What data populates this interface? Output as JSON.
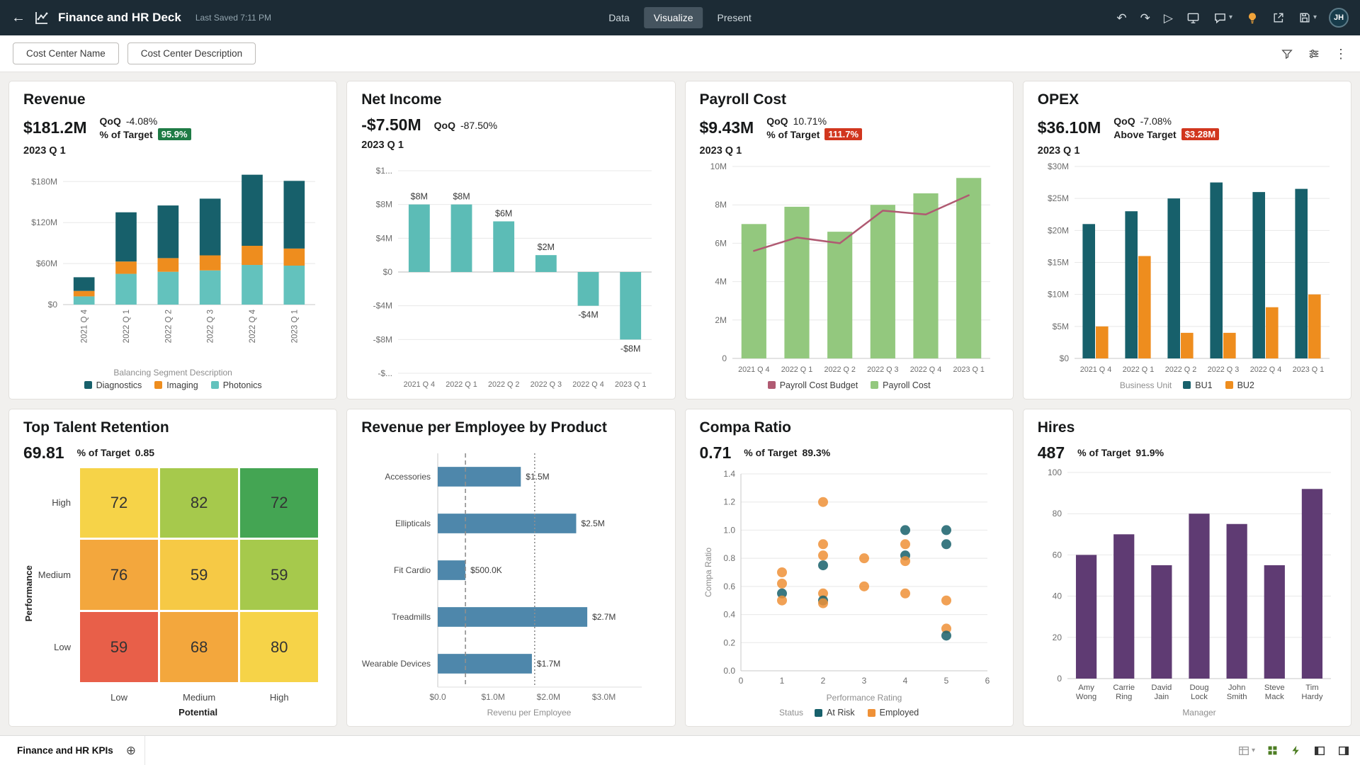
{
  "topbar": {
    "title": "Finance and HR Deck",
    "last_saved": "Last Saved 7:11 PM",
    "tabs": [
      {
        "label": "Data",
        "active": false
      },
      {
        "label": "Visualize",
        "active": true
      },
      {
        "label": "Present",
        "active": false
      }
    ],
    "avatar_initials": "JH"
  },
  "filterbar": {
    "chips": [
      {
        "label": "Cost Center Name"
      },
      {
        "label": "Cost Center Description"
      }
    ]
  },
  "bottombar": {
    "active_tab": "Finance and HR KPIs"
  },
  "tiles": [
    {
      "title": "Revenue",
      "value": "$181.2M",
      "qoq_label": "QoQ",
      "qoq_value": "-4.08%",
      "target_label": "% of Target",
      "target_value": "95.9%",
      "target_badge": "green",
      "period": "2023 Q 1",
      "legend_title": "Balancing Segment Description"
    },
    {
      "title": "Net Income",
      "value": "-$7.50M",
      "qoq_label": "QoQ",
      "qoq_value": "-87.50%",
      "period": "2023 Q 1"
    },
    {
      "title": "Payroll Cost",
      "value": "$9.43M",
      "qoq_label": "QoQ",
      "qoq_value": "10.71%",
      "target_label": "% of Target",
      "target_value": "111.7%",
      "target_badge": "red",
      "period": "2023 Q 1"
    },
    {
      "title": "OPEX",
      "value": "$36.10M",
      "qoq_label": "QoQ",
      "qoq_value": "-7.08%",
      "target_label": "Above Target",
      "target_value": "$3.28M",
      "target_badge": "red",
      "period": "2023 Q 1",
      "legend_title": "Business Unit"
    },
    {
      "title": "Top Talent Retention",
      "value": "69.81",
      "target_label": "% of Target",
      "target_value": "0.85"
    },
    {
      "title": "Revenue per Employee by Product"
    },
    {
      "title": "Compa Ratio",
      "value": "0.71",
      "target_label": "% of Target",
      "target_value": "89.3%",
      "legend_title": "Status"
    },
    {
      "title": "Hires",
      "value": "487",
      "target_label": "% of Target",
      "target_value": "91.9%"
    }
  ],
  "chart_data": [
    {
      "type": "stacked-bar",
      "title": "Revenue",
      "categories": [
        "2021 Q 4",
        "2022 Q 1",
        "2022 Q 2",
        "2022 Q 3",
        "2022 Q 4",
        "2023 Q 1"
      ],
      "series": [
        {
          "name": "Diagnostics",
          "color": "#17606b",
          "values": [
            20,
            72,
            77,
            83,
            104,
            99
          ]
        },
        {
          "name": "Imaging",
          "color": "#ee8d1e",
          "values": [
            8,
            18,
            20,
            22,
            28,
            25
          ]
        },
        {
          "name": "Photonics",
          "color": "#63c2bd",
          "values": [
            12,
            45,
            48,
            50,
            58,
            57
          ]
        }
      ],
      "ylim": [
        0,
        200
      ],
      "yticks": [
        {
          "v": 0,
          "label": "$0"
        },
        {
          "v": 60,
          "label": "$60M"
        },
        {
          "v": 120,
          "label": "$120M"
        },
        {
          "v": 180,
          "label": "$180M"
        }
      ],
      "legend_title": "Balancing Segment Description"
    },
    {
      "type": "bar",
      "title": "Net Income",
      "categories": [
        "2021 Q 4",
        "2022 Q 1",
        "2022 Q 2",
        "2022 Q 3",
        "2022 Q 4",
        "2023 Q 1"
      ],
      "values": [
        8,
        8,
        6,
        2,
        -4,
        -8
      ],
      "bar_labels": [
        "$8M",
        "$8M",
        "$6M",
        "$2M",
        "-$4M",
        "-$8M"
      ],
      "color": "#5cbcb6",
      "ylim": [
        -12,
        12
      ],
      "yticks": [
        {
          "v": 12,
          "label": "$1..."
        },
        {
          "v": 8,
          "label": "$8M"
        },
        {
          "v": 4,
          "label": "$4M"
        },
        {
          "v": 0,
          "label": "$0"
        },
        {
          "v": -4,
          "label": "-$4M"
        },
        {
          "v": -8,
          "label": "-$8M"
        },
        {
          "v": -12,
          "label": "-$..."
        }
      ]
    },
    {
      "type": "combo",
      "title": "Payroll Cost",
      "categories": [
        "2021 Q 4",
        "2022 Q 1",
        "2022 Q 2",
        "2022 Q 3",
        "2022 Q 4",
        "2023 Q 1"
      ],
      "bar_series": {
        "name": "Payroll Cost",
        "color": "#93c87e",
        "values": [
          7,
          7.9,
          6.6,
          8,
          8.6,
          9.4
        ]
      },
      "line_series": {
        "name": "Payroll Cost Budget",
        "color": "#b05a72",
        "values": [
          5.6,
          6.3,
          6,
          7.7,
          7.5,
          8.5
        ]
      },
      "ylim": [
        0,
        10
      ],
      "yticks": [
        {
          "v": 0,
          "label": "0"
        },
        {
          "v": 2,
          "label": "2M"
        },
        {
          "v": 4,
          "label": "4M"
        },
        {
          "v": 6,
          "label": "6M"
        },
        {
          "v": 8,
          "label": "8M"
        },
        {
          "v": 10,
          "label": "10M"
        }
      ]
    },
    {
      "type": "grouped-bar",
      "title": "OPEX",
      "categories": [
        "2021 Q 4",
        "2022 Q 1",
        "2022 Q 2",
        "2022 Q 3",
        "2022 Q 4",
        "2023 Q 1"
      ],
      "series": [
        {
          "name": "BU1",
          "color": "#17606b",
          "values": [
            21,
            23,
            25,
            27.5,
            26,
            26.5
          ]
        },
        {
          "name": "BU2",
          "color": "#ee8d1e",
          "values": [
            5,
            16,
            4,
            4,
            8,
            10
          ]
        }
      ],
      "ylim": [
        0,
        30
      ],
      "yticks": [
        {
          "v": 0,
          "label": "$0"
        },
        {
          "v": 5,
          "label": "$5M"
        },
        {
          "v": 10,
          "label": "$10M"
        },
        {
          "v": 15,
          "label": "$15M"
        },
        {
          "v": 20,
          "label": "$20M"
        },
        {
          "v": 25,
          "label": "$25M"
        },
        {
          "v": 30,
          "label": "$30M"
        }
      ],
      "legend_title": "Business Unit"
    },
    {
      "type": "heatmap",
      "title": "Top Talent Retention",
      "x_title": "Potential",
      "y_title": "Performance",
      "col_labels": [
        "Low",
        "Medium",
        "High"
      ],
      "rows": [
        {
          "label": "High",
          "cells": [
            {
              "value": 72,
              "color": "#f6d348"
            },
            {
              "value": 82,
              "color": "#a6c94c"
            },
            {
              "value": 72,
              "color": "#44a553"
            }
          ]
        },
        {
          "label": "Medium",
          "cells": [
            {
              "value": 76,
              "color": "#f3a73d"
            },
            {
              "value": 59,
              "color": "#f6c945"
            },
            {
              "value": 59,
              "color": "#a6c94c"
            }
          ]
        },
        {
          "label": "Low",
          "cells": [
            {
              "value": 59,
              "color": "#e85f49"
            },
            {
              "value": 68,
              "color": "#f3a73d"
            },
            {
              "value": 80,
              "color": "#f6d348"
            }
          ]
        }
      ]
    },
    {
      "type": "hbar",
      "title": "Revenue per Employee by Product",
      "categories": [
        "Accessories",
        "Ellipticals",
        "Fit Cardio",
        "Treadmills",
        "Wearable Devices"
      ],
      "values": [
        1.5,
        2.5,
        0.5,
        2.7,
        1.7
      ],
      "bar_labels": [
        "$1.5M",
        "$2.5M",
        "$500.0K",
        "$2.7M",
        "$1.7M"
      ],
      "color": "#4e87ab",
      "xlim": [
        0,
        3.3
      ],
      "xticks": [
        {
          "v": 0,
          "label": "$0.0"
        },
        {
          "v": 1,
          "label": "$1.0M"
        },
        {
          "v": 2,
          "label": "$2.0M"
        },
        {
          "v": 3,
          "label": "$3.0M"
        }
      ],
      "ref_lines": [
        {
          "v": 0.5,
          "style": "dashed"
        },
        {
          "v": 1.75,
          "style": "dotted"
        }
      ],
      "x_title": "Revenu per Employee"
    },
    {
      "type": "scatter",
      "title": "Compa Ratio",
      "x_title": "Performance Rating",
      "y_title": "Compa Ratio",
      "xlim": [
        0,
        6
      ],
      "ylim": [
        0,
        1.4
      ],
      "xticks": [
        0,
        1,
        2,
        3,
        4,
        5,
        6
      ],
      "yticks": [
        0,
        0.2,
        0.4,
        0.6,
        0.8,
        1,
        1.2,
        1.4
      ],
      "legend_title": "Status",
      "statuses": [
        {
          "name": "At Risk",
          "color": "#17606b"
        },
        {
          "name": "Employed",
          "color": "#ef9137"
        }
      ],
      "points": [
        {
          "x": 1,
          "y": 0.7,
          "s": "Employed"
        },
        {
          "x": 1,
          "y": 0.62,
          "s": "Employed"
        },
        {
          "x": 1,
          "y": 0.55,
          "s": "At Risk"
        },
        {
          "x": 1,
          "y": 0.5,
          "s": "Employed"
        },
        {
          "x": 2,
          "y": 1.2,
          "s": "Employed"
        },
        {
          "x": 2,
          "y": 0.9,
          "s": "Employed"
        },
        {
          "x": 2,
          "y": 0.82,
          "s": "Employed"
        },
        {
          "x": 2,
          "y": 0.75,
          "s": "At Risk"
        },
        {
          "x": 2,
          "y": 0.55,
          "s": "Employed"
        },
        {
          "x": 2,
          "y": 0.5,
          "s": "At Risk"
        },
        {
          "x": 2,
          "y": 0.48,
          "s": "Employed"
        },
        {
          "x": 3,
          "y": 0.8,
          "s": "Employed"
        },
        {
          "x": 3,
          "y": 0.6,
          "s": "Employed"
        },
        {
          "x": 4,
          "y": 1,
          "s": "At Risk"
        },
        {
          "x": 4,
          "y": 0.9,
          "s": "Employed"
        },
        {
          "x": 4,
          "y": 0.82,
          "s": "At Risk"
        },
        {
          "x": 4,
          "y": 0.78,
          "s": "Employed"
        },
        {
          "x": 4,
          "y": 0.55,
          "s": "Employed"
        },
        {
          "x": 5,
          "y": 1,
          "s": "At Risk"
        },
        {
          "x": 5,
          "y": 0.9,
          "s": "At Risk"
        },
        {
          "x": 5,
          "y": 0.5,
          "s": "Employed"
        },
        {
          "x": 5,
          "y": 0.3,
          "s": "Employed"
        },
        {
          "x": 5,
          "y": 0.25,
          "s": "At Risk"
        }
      ]
    },
    {
      "type": "vbar",
      "title": "Hires",
      "categories": [
        "Amy Wong",
        "Carrie Ring",
        "David Jain",
        "Doug Lock",
        "John Smith",
        "Steve Mack",
        "Tim Hardy"
      ],
      "values": [
        60,
        70,
        55,
        80,
        75,
        55,
        92
      ],
      "color": "#5f3b73",
      "ylim": [
        0,
        100
      ],
      "yticks": [
        {
          "v": 0,
          "label": "0"
        },
        {
          "v": 20,
          "label": "20"
        },
        {
          "v": 40,
          "label": "40"
        },
        {
          "v": 60,
          "label": "60"
        },
        {
          "v": 80,
          "label": "80"
        },
        {
          "v": 100,
          "label": "100"
        }
      ],
      "x_title": "Manager"
    }
  ]
}
